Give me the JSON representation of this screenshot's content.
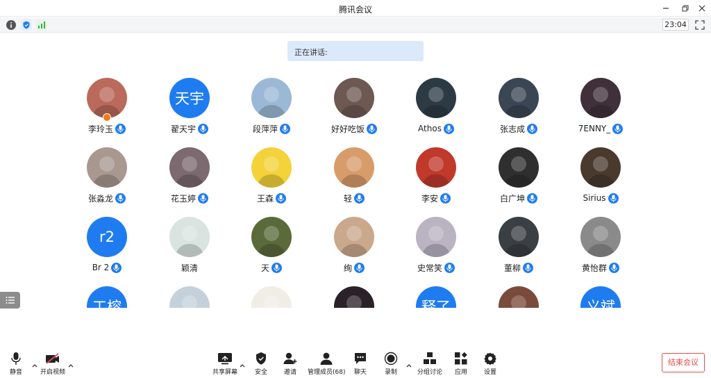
{
  "window": {
    "title": "腾讯会议"
  },
  "status": {
    "clock": "23:04"
  },
  "speaking": {
    "label": "正在讲话:"
  },
  "participants": [
    {
      "name": "李玲玉",
      "avatar": "photo",
      "color": "#b96a5b",
      "mic": true,
      "host": true
    },
    {
      "name": "翟天宇",
      "avatar": "text",
      "avatar_text": "天宇",
      "mic": true
    },
    {
      "name": "段萍萍",
      "avatar": "photo",
      "color": "#9bb9d6",
      "mic": true
    },
    {
      "name": "好好吃饭",
      "avatar": "photo",
      "color": "#6e5852",
      "mic": true
    },
    {
      "name": "Athos",
      "avatar": "photo",
      "color": "#2c3a44",
      "mic": true
    },
    {
      "name": "张志成",
      "avatar": "photo",
      "color": "#3a4654",
      "mic": true
    },
    {
      "name": "7ENNY_",
      "avatar": "photo",
      "color": "#40303a",
      "mic": true
    },
    {
      "name": "张淼龙",
      "avatar": "photo",
      "color": "#a89890",
      "mic": true
    },
    {
      "name": "花玉婷",
      "avatar": "photo",
      "color": "#7c6a70",
      "mic": true
    },
    {
      "name": "王森",
      "avatar": "photo",
      "color": "#f3d23a",
      "mic": true
    },
    {
      "name": "轻",
      "avatar": "photo",
      "color": "#d89c6a",
      "mic": true
    },
    {
      "name": "李安",
      "avatar": "photo",
      "color": "#c0392b",
      "mic": true
    },
    {
      "name": "白广坤",
      "avatar": "photo",
      "color": "#2f2f2f",
      "mic": true
    },
    {
      "name": "Sirius",
      "avatar": "photo",
      "color": "#4a3a2e",
      "mic": true
    },
    {
      "name": "Br 2",
      "avatar": "text",
      "avatar_text": "r2",
      "mic": true
    },
    {
      "name": "颖清",
      "avatar": "photo",
      "color": "#d9e4e0",
      "mic": false
    },
    {
      "name": "天",
      "avatar": "photo",
      "color": "#5a6a3a",
      "mic": true
    },
    {
      "name": "绚",
      "avatar": "photo",
      "color": "#caa88c",
      "mic": true
    },
    {
      "name": "史常笑",
      "avatar": "photo",
      "color": "#b9b3c2",
      "mic": true
    },
    {
      "name": "董柳",
      "avatar": "photo",
      "color": "#3a3f44",
      "mic": true
    },
    {
      "name": "黄怡群",
      "avatar": "photo",
      "color": "#8a8a8a",
      "mic": true
    },
    {
      "name": "",
      "avatar": "text",
      "avatar_text": "工榕",
      "mic": false
    },
    {
      "name": "",
      "avatar": "photo",
      "color": "#c4d1db",
      "mic": false
    },
    {
      "name": "",
      "avatar": "photo",
      "color": "#f0ede6",
      "mic": false
    },
    {
      "name": "",
      "avatar": "photo",
      "color": "#2a2228",
      "mic": false
    },
    {
      "name": "",
      "avatar": "text",
      "avatar_text": "释了",
      "mic": false
    },
    {
      "name": "",
      "avatar": "photo",
      "color": "#7a4a3a",
      "mic": false
    },
    {
      "name": "",
      "avatar": "text",
      "avatar_text": "义斌",
      "mic": false
    }
  ],
  "toolbar": {
    "mute": "静音",
    "video": "开启视频",
    "share": "共享屏幕",
    "security": "安全",
    "invite": "邀请",
    "members": "管理成员(68)",
    "chat": "聊天",
    "record": "录制",
    "breakout": "分组讨论",
    "apps": "应用",
    "settings": "设置",
    "end": "结束会议"
  },
  "colors": {
    "accent": "#1f7cf0",
    "speaking_bg": "#dce9fb",
    "end": "#e84a4a"
  }
}
